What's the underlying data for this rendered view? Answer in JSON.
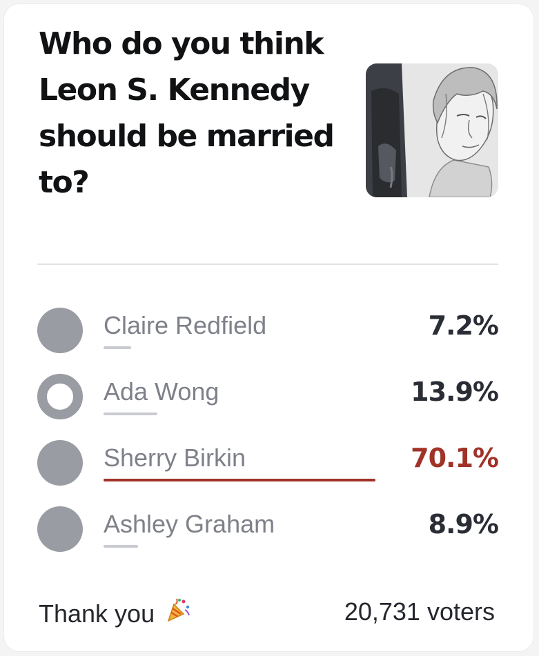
{
  "poll": {
    "question": "Who do you think Leon S. Kennedy should be married to?",
    "options": [
      {
        "label": "Claire Redfield",
        "percent": "7.2%",
        "share": 0.072,
        "selected": false,
        "winner": false
      },
      {
        "label": "Ada Wong",
        "percent": "13.9%",
        "share": 0.139,
        "selected": true,
        "winner": false
      },
      {
        "label": "Sherry Birkin",
        "percent": "70.1%",
        "share": 0.701,
        "selected": false,
        "winner": true
      },
      {
        "label": "Ashley Graham",
        "percent": "8.9%",
        "share": 0.089,
        "selected": false,
        "winner": false
      }
    ],
    "accent_color": "#a03227",
    "neutral_color": "#9a9ca4"
  },
  "footer": {
    "thank_you": "Thank you",
    "thank_you_icon": "party-popper-icon",
    "voters": "20,731 voters"
  }
}
